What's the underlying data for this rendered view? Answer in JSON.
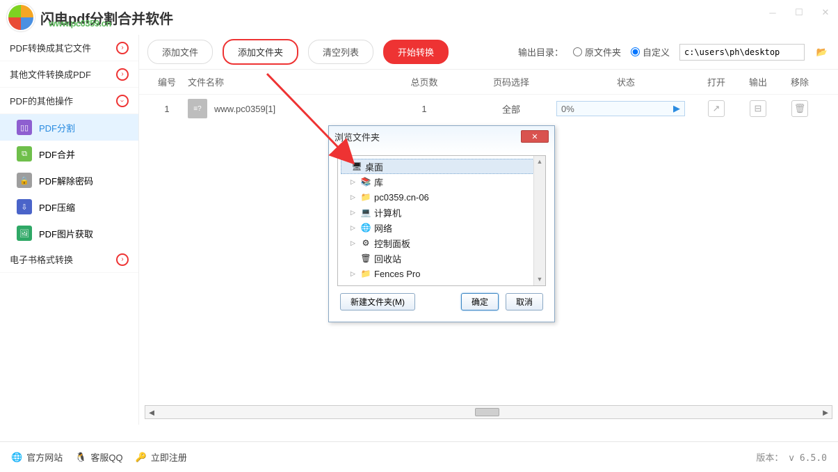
{
  "app": {
    "title": "闪电pdf分割合并软件",
    "watermark": "www.pc0359.cn"
  },
  "sidebar": {
    "cat1": "PDF转换成其它文件",
    "cat2": "其他文件转换成PDF",
    "cat3": "PDF的其他操作",
    "cat4": "电子书格式转换",
    "items": [
      {
        "label": "PDF分割",
        "color": "#8e5fd0"
      },
      {
        "label": "PDF合并",
        "color": "#6fbf4b"
      },
      {
        "label": "PDF解除密码",
        "color": "#9e9e9e"
      },
      {
        "label": "PDF压缩",
        "color": "#4a64c9"
      },
      {
        "label": "PDF图片获取",
        "color": "#2fa866"
      }
    ]
  },
  "toolbar": {
    "add_file": "添加文件",
    "add_folder": "添加文件夹",
    "clear": "清空列表",
    "start": "开始转换",
    "out_label": "输出目录：",
    "radio_orig": "原文件夹",
    "radio_custom": "自定义",
    "path": "c:\\users\\ph\\desktop"
  },
  "table": {
    "h_num": "编号",
    "h_name": "文件名称",
    "h_pages": "总页数",
    "h_sel": "页码选择",
    "h_stat": "状态",
    "h_open": "打开",
    "h_out": "输出",
    "h_del": "移除",
    "rows": [
      {
        "num": "1",
        "name": "www.pc0359[1]",
        "pages": "1",
        "sel": "全部",
        "stat": "0%"
      }
    ]
  },
  "dialog": {
    "title": "浏览文件夹",
    "nodes": [
      {
        "label": "桌面",
        "icon": "🖥",
        "root": true
      },
      {
        "label": "库",
        "icon": "📚",
        "exp": "▷"
      },
      {
        "label": "pc0359.cn-06",
        "icon": "📁",
        "exp": "▷"
      },
      {
        "label": "计算机",
        "icon": "💻",
        "exp": "▷"
      },
      {
        "label": "网络",
        "icon": "🌐",
        "exp": "▷"
      },
      {
        "label": "控制面板",
        "icon": "⚙",
        "exp": "▷"
      },
      {
        "label": "回收站",
        "icon": "🗑",
        "exp": ""
      },
      {
        "label": "Fences Pro",
        "icon": "📁",
        "exp": "▷"
      }
    ],
    "new_folder": "新建文件夹(M)",
    "ok": "确定",
    "cancel": "取消"
  },
  "footer": {
    "site": "官方网站",
    "qq": "客服QQ",
    "reg": "立即注册",
    "version": "版本： v 6.5.0"
  }
}
